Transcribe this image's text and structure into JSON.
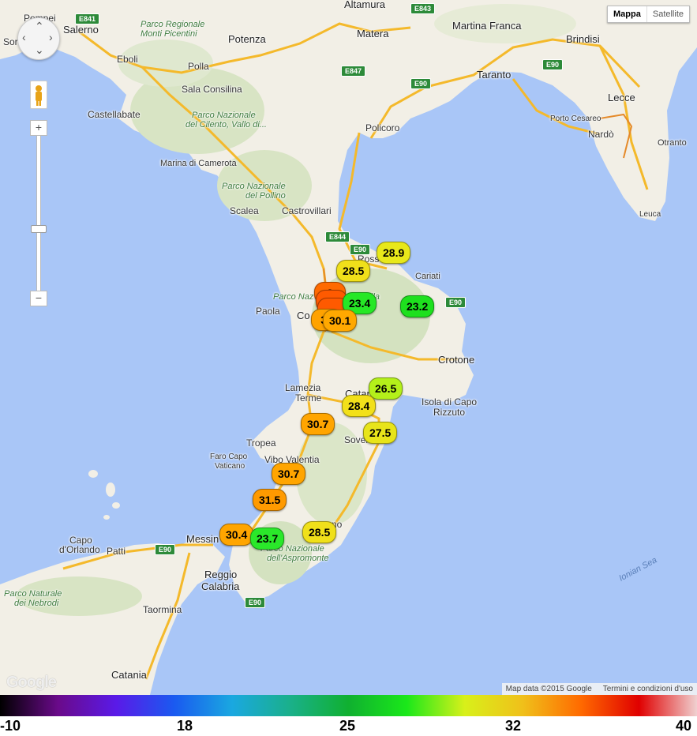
{
  "map_type": {
    "active": "Mappa",
    "inactive": "Satellite"
  },
  "attribution": {
    "data": "Map data ©2015 Google",
    "terms": "Termini e condizioni d'uso"
  },
  "google_logo": "Google",
  "places": {
    "salerno": "Salerno",
    "pompei": "Pompei",
    "sorrento": "Sor",
    "potenza": "Potenza",
    "eboli": "Eboli",
    "polla": "Polla",
    "sala": "Sala Consilina",
    "castellabate": "Castellabate",
    "marina_camerota": "Marina di Camerota",
    "matera": "Matera",
    "altamura": "Altamura",
    "martina": "Martina Franca",
    "brindisi": "Brindisi",
    "taranto": "Taranto",
    "lecce": "Lecce",
    "porto_cesareo": "Porto Cesareo",
    "nardo": "Nardò",
    "otranto": "Otranto",
    "leuca": "Leuca",
    "policoro": "Policoro",
    "scalea": "Scalea",
    "castrovillari": "Castrovillari",
    "paola": "Paola",
    "cosenza": "Co",
    "rossano": "Ross",
    "cariati": "Cariati",
    "crotone": "Crotone",
    "isola_capo": "Isola di Capo",
    "rizzuto": "Rizzuto",
    "lamezia": "Lamezia",
    "terme": "Terme",
    "catanzaro": "Catan",
    "soverato": "Soverato",
    "tropea": "Tropea",
    "vibo": "Vibo Valentia",
    "faro_capo": "Faro Capo",
    "vaticano": "Vaticano",
    "capo_orlando": "Capo",
    "orlando": "d'Orlando",
    "patti": "Patti",
    "messina": "Messin",
    "reggio": "Reggio",
    "calabria": "Calabria",
    "taormina": "Taormina",
    "catania": "Catania",
    "locri": "no"
  },
  "parks": {
    "picentini": "Parco Regionale",
    "picentini2": "Monti Picentini",
    "cilento": "Parco Nazionale",
    "cilento2": "del Cilento, Vallo di...",
    "pollino": "Parco Nazionale",
    "pollino2": "del Pollino",
    "sila": "Parco Naz",
    "sila2": "ila",
    "aspromonte": "Parco Nazionale",
    "aspromonte2": "dell'Aspromonte",
    "nebrodi": "Parco Naturale",
    "nebrodi2": "dei Nebrodi"
  },
  "sea": {
    "ionian": "Ionian Sea"
  },
  "roads": [
    "E841",
    "E843",
    "E847",
    "E90",
    "E90",
    "E844",
    "E90",
    "E90",
    "E90",
    "E90"
  ],
  "markers": [
    {
      "label": "28.9",
      "color": "#e8e81a"
    },
    {
      "label": "28.5",
      "color": "#f0e01a"
    },
    {
      "label": "3",
      "color": "#ff6a00"
    },
    {
      "label": "23.4",
      "color": "#26e826"
    },
    {
      "label": "23.2",
      "color": "#1ee01e"
    },
    {
      "label": "30",
      "color": "#ffa200"
    },
    {
      "label": "30.1",
      "color": "#ffa800"
    },
    {
      "label": "26.5",
      "color": "#b4f01a"
    },
    {
      "label": "28.4",
      "color": "#f2e01a"
    },
    {
      "label": "30.7",
      "color": "#ffa500"
    },
    {
      "label": "27.5",
      "color": "#e8e41a"
    },
    {
      "label": "30.7",
      "color": "#ffa500"
    },
    {
      "label": "31.5",
      "color": "#ff9a00"
    },
    {
      "label": "30.4",
      "color": "#ffa500"
    },
    {
      "label": "23.7",
      "color": "#2ae82a"
    },
    {
      "label": "28.5",
      "color": "#f0e01a"
    }
  ],
  "legend": {
    "ticks": [
      "-10",
      "18",
      "25",
      "32",
      "40"
    ],
    "gradient_colors": [
      "#000000",
      "#6a0a8a",
      "#5a1ae8",
      "#1a5af0",
      "#1aa8e0",
      "#1ab08a",
      "#10b030",
      "#1ae81a",
      "#d8f01a",
      "#f0c01a",
      "#ff6a00",
      "#e00000",
      "#f0d0d0"
    ]
  }
}
